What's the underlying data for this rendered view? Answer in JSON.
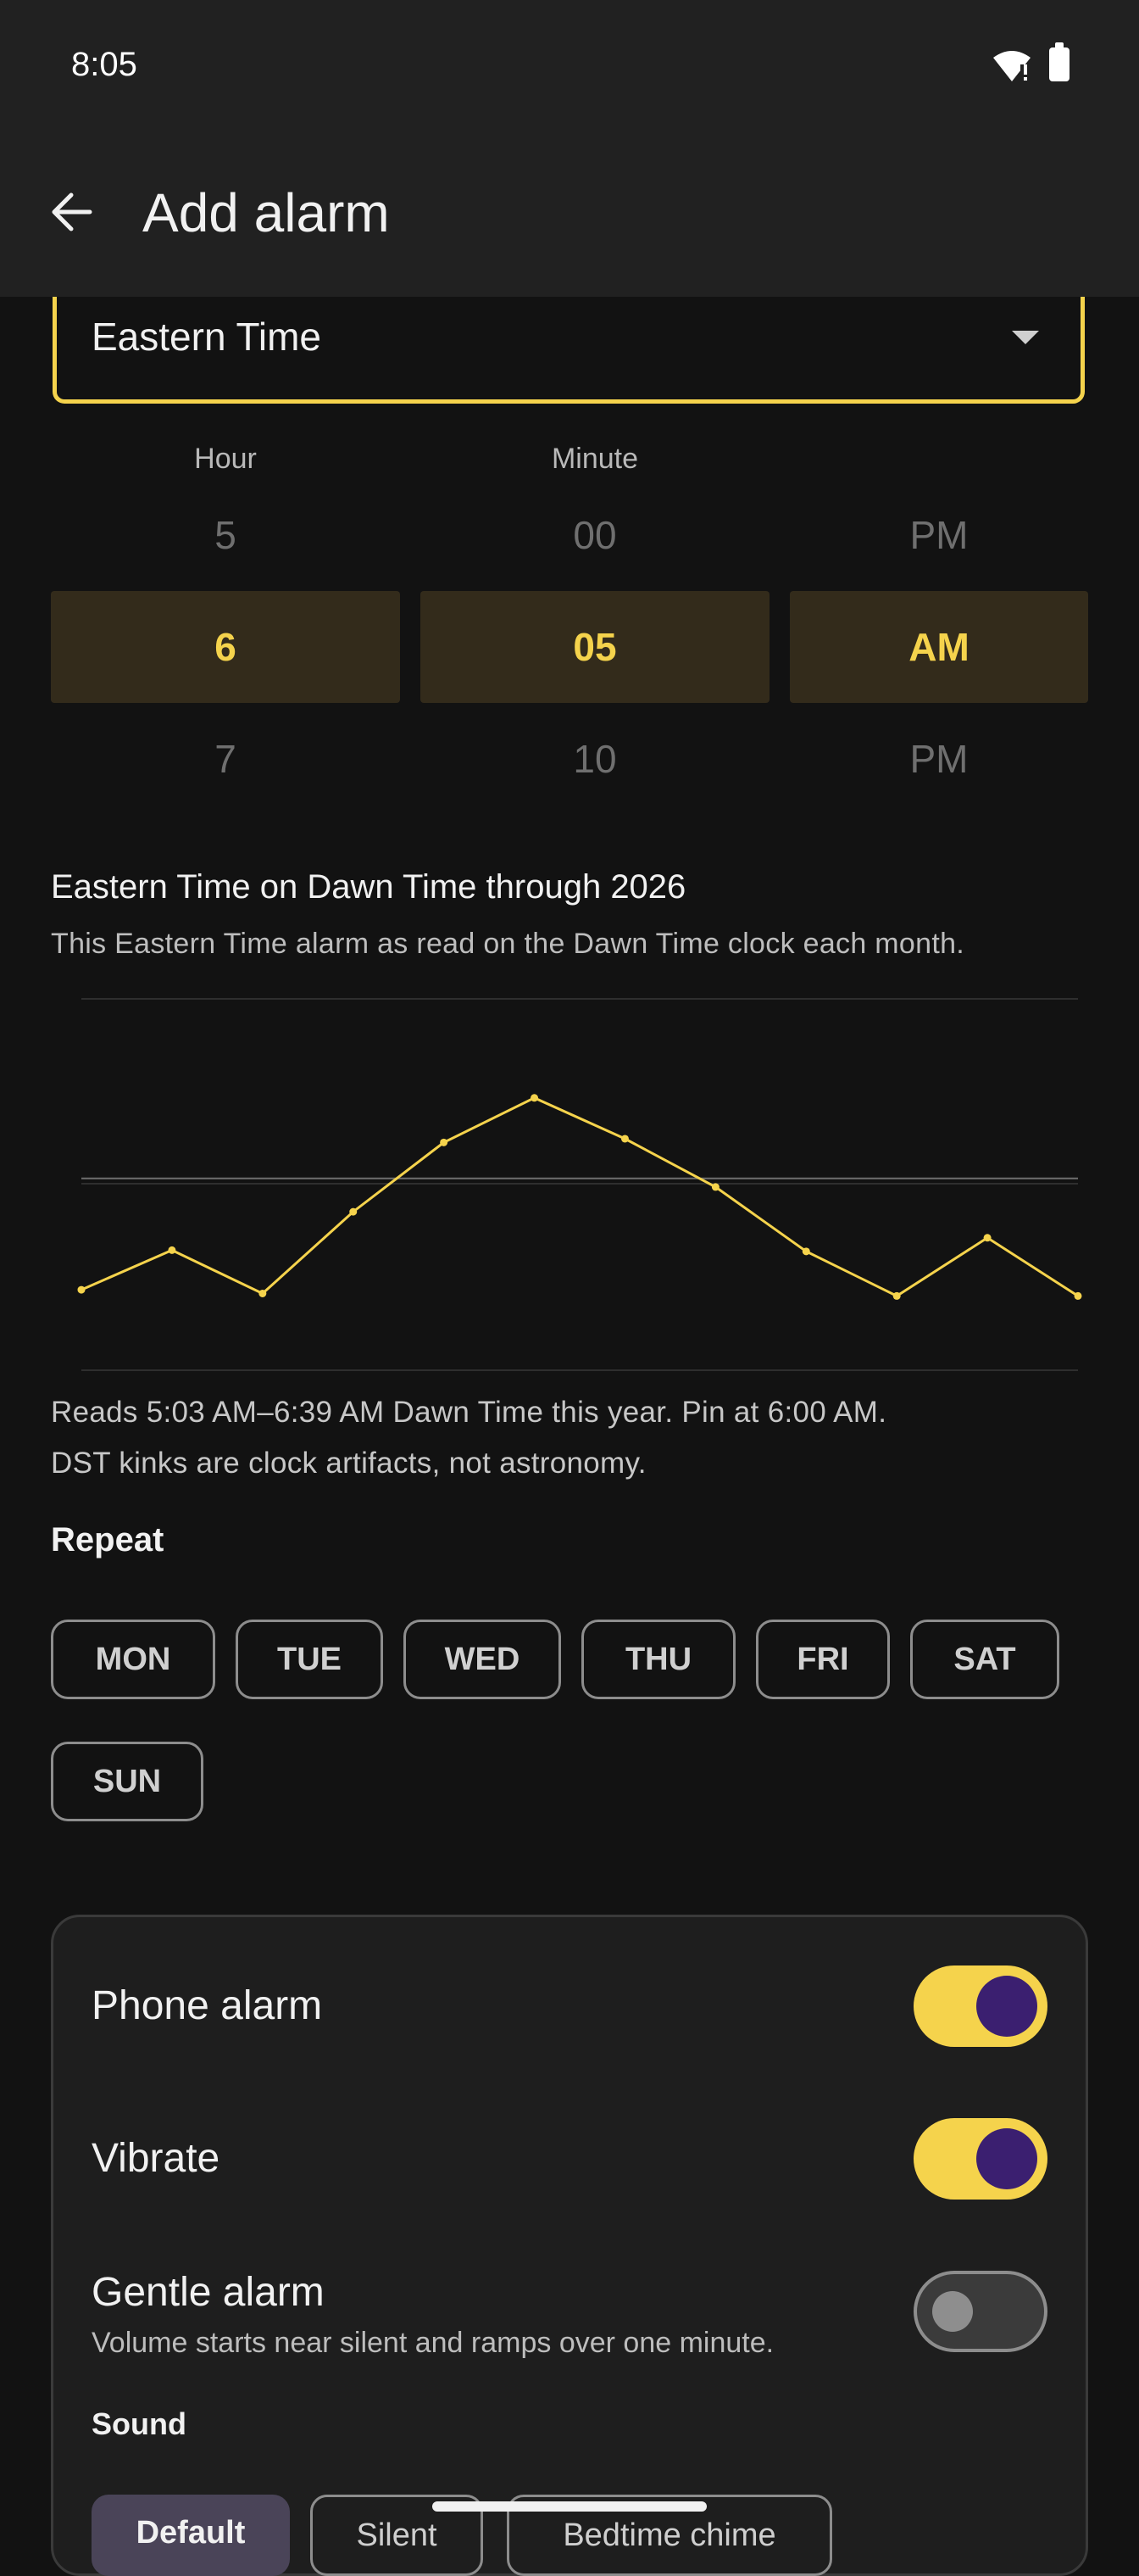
{
  "status_bar": {
    "time": "8:05"
  },
  "app_bar": {
    "title": "Add alarm"
  },
  "timezone": {
    "value": "Eastern Time"
  },
  "picker": {
    "hour": {
      "label": "Hour",
      "prev": "5",
      "selected": "6",
      "next": "7"
    },
    "minute": {
      "label": "Minute",
      "prev": "00",
      "selected": "05",
      "next": "10"
    },
    "ampm": {
      "prev": "PM",
      "selected": "AM",
      "next": "PM"
    }
  },
  "chart_section": {
    "title": "Eastern Time on Dawn Time through 2026",
    "subtitle": "This Eastern Time alarm as read on the Dawn Time clock each month.",
    "reading_line1": "Reads 5:03 AM–6:39 AM Dawn Time this year. Pin at 6:00 AM.",
    "reading_line2": "DST kinks are clock artifacts, not astronomy."
  },
  "chart_data": {
    "type": "line",
    "title": "Eastern Time on Dawn Time through 2026",
    "x": [
      1,
      2,
      3,
      4,
      5,
      6,
      7,
      8,
      9,
      10,
      11,
      12
    ],
    "series": [
      {
        "values": [
          5.1,
          5.42,
          5.07,
          5.73,
          6.29,
          6.65,
          6.32,
          5.93,
          5.41,
          5.05,
          5.52,
          5.05
        ]
      }
    ],
    "reference_line": 6.0,
    "ylim": [
      4.45,
      7.45
    ],
    "line_color": "#f5d34c",
    "grid": true
  },
  "repeat": {
    "label": "Repeat",
    "days": [
      "MON",
      "TUE",
      "WED",
      "THU",
      "FRI",
      "SAT",
      "SUN"
    ]
  },
  "options": {
    "phone_alarm": {
      "label": "Phone alarm",
      "on": true
    },
    "vibrate": {
      "label": "Vibrate",
      "on": true
    },
    "gentle_alarm": {
      "label": "Gentle alarm",
      "sub": "Volume starts near silent and ramps over one minute.",
      "on": false
    }
  },
  "sound": {
    "label": "Sound",
    "choices": [
      "Default",
      "Silent",
      "Bedtime chime"
    ],
    "selected": "Default"
  },
  "colors": {
    "accent": "#f5d34c",
    "toggle_knob": "#3b1f70",
    "background": "#121212"
  }
}
